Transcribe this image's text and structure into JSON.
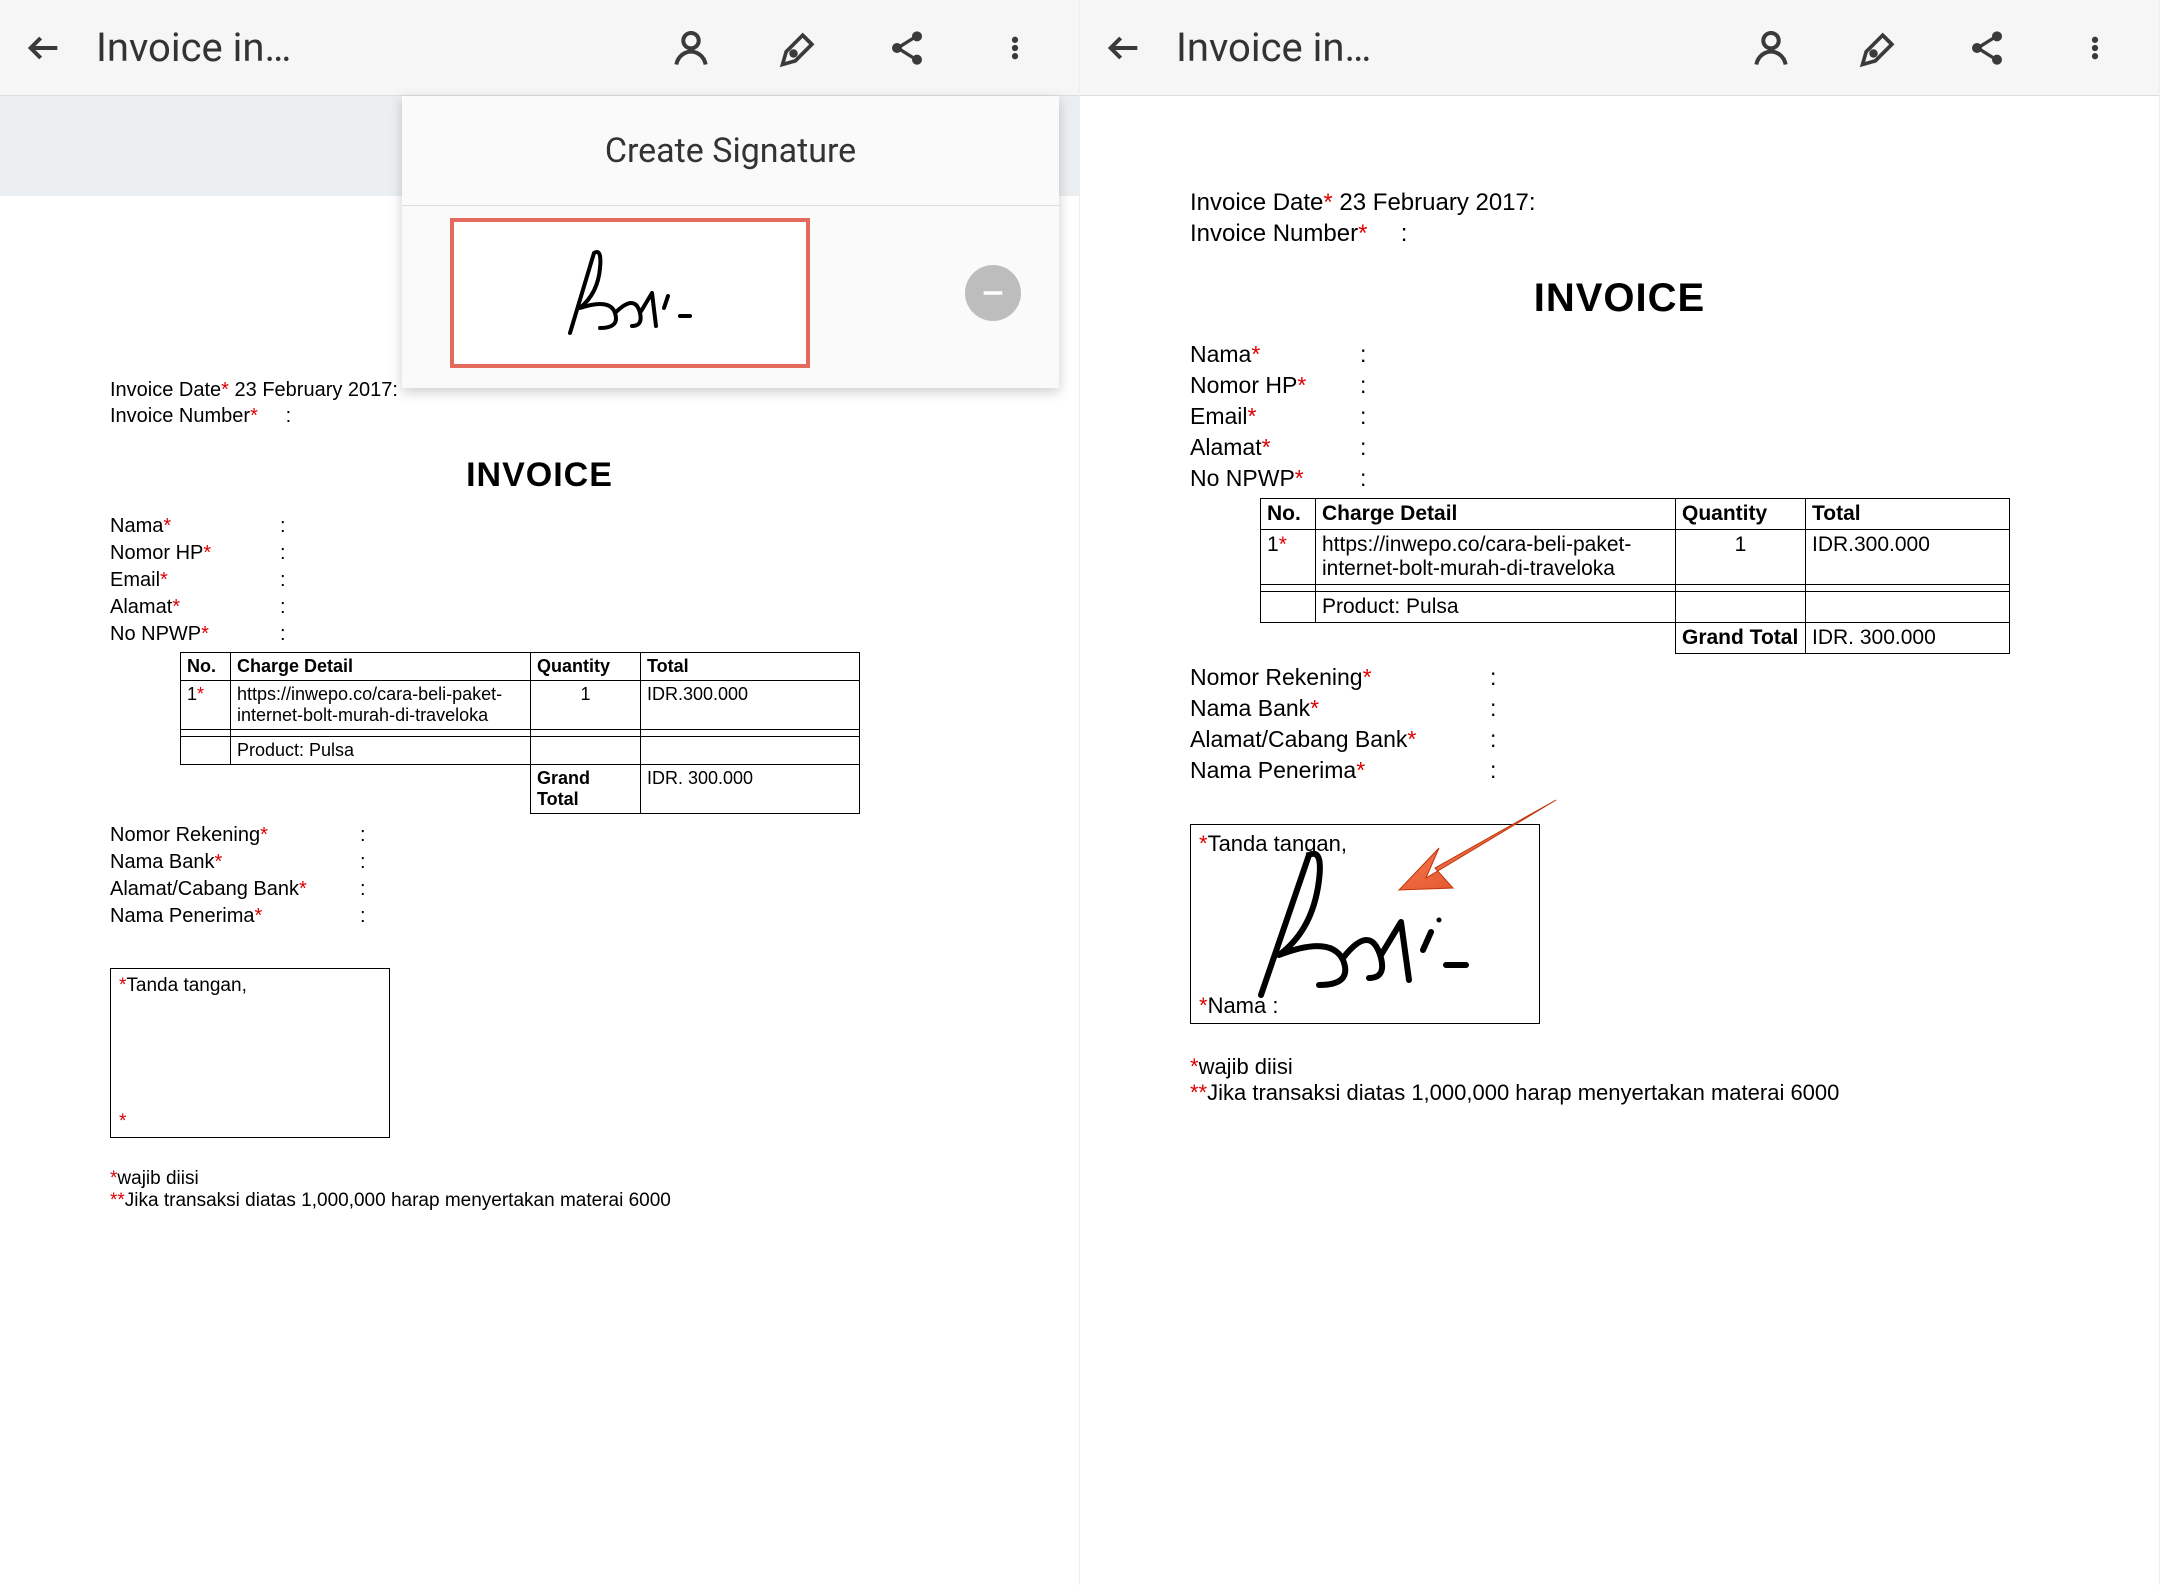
{
  "toolbar": {
    "title": "Invoice in…"
  },
  "panel": {
    "create_signature": "Create Signature"
  },
  "doc": {
    "invoice_date_label": "Invoice Date",
    "invoice_date_value": " 23 February 2017:",
    "invoice_number_label": "Invoice Number",
    "heading": "INVOICE",
    "fields": {
      "nama": "Nama",
      "nomor_hp": "Nomor HP",
      "email": "Email",
      "alamat": "Alamat",
      "no_npwp": "No NPWP"
    },
    "table": {
      "h_no": "No.",
      "h_charge": "Charge Detail",
      "h_qty": "Quantity",
      "h_total": "Total",
      "row_no": "1",
      "row_charge": "https://inwepo.co/cara-beli-paket-internet-bolt-murah-di-traveloka",
      "row_qty": "1",
      "row_total": "IDR.300.000",
      "product": "Product: Pulsa",
      "grand_total_label": "Grand Total",
      "grand_total_value": "IDR. 300.000"
    },
    "bank": {
      "nomor_rekening": "Nomor Rekening",
      "nama_bank": "Nama Bank",
      "alamat_bank": "Alamat/Cabang Bank",
      "nama_penerima": "Nama Penerima"
    },
    "sig": {
      "tanda_tangan": "Tanda tangan,",
      "nama": "Nama :"
    },
    "footnotes": {
      "wajib": "wajib diisi",
      "materai": "Jika transaksi diatas 1,000,000 harap menyertakan materai 6000"
    }
  }
}
